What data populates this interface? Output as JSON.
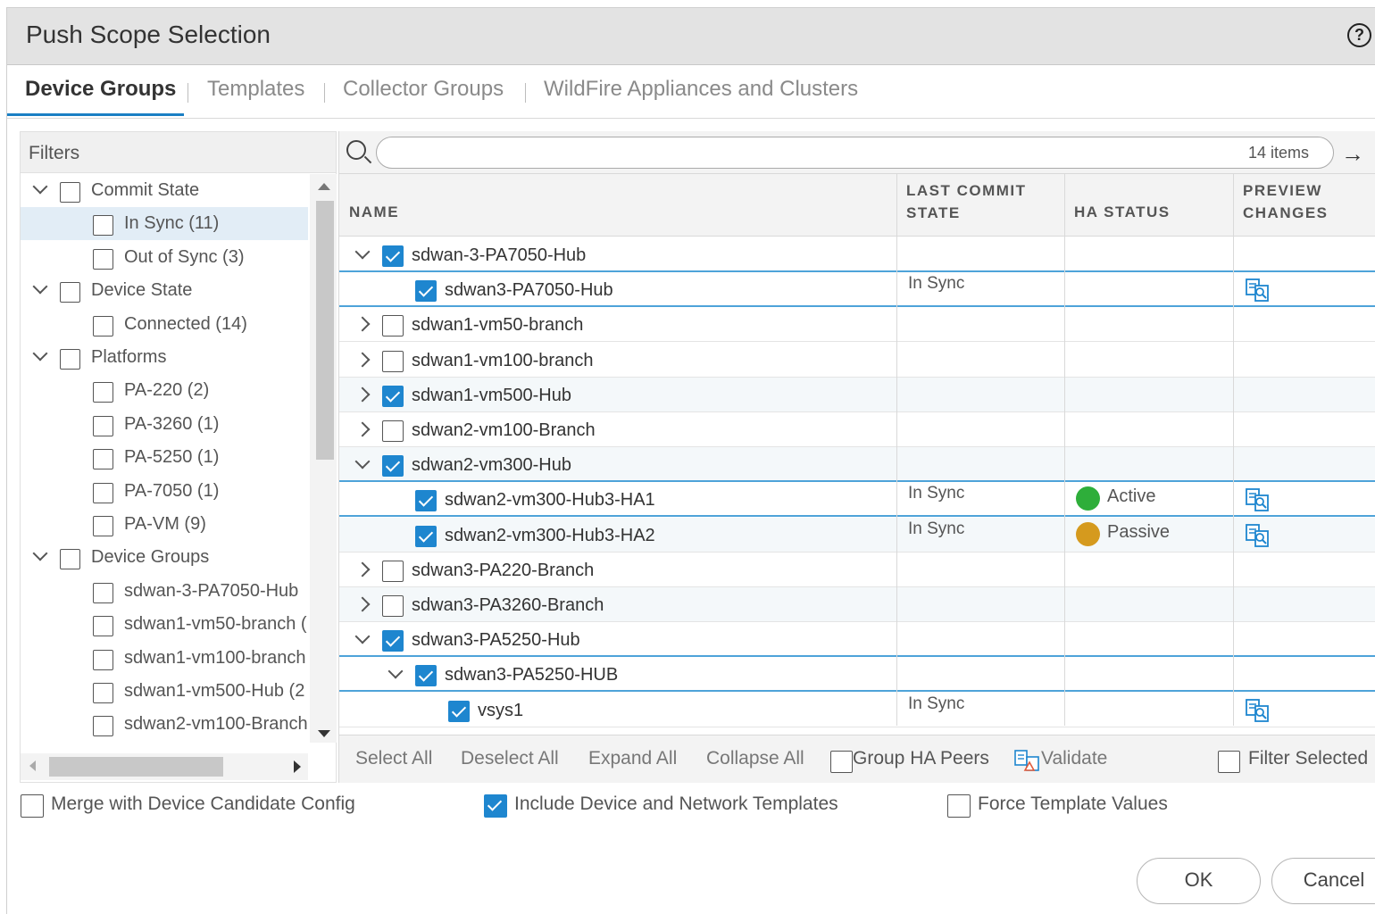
{
  "dialog": {
    "title": "Push Scope Selection",
    "help_icon": "question-circle-icon",
    "help_text": "?"
  },
  "tabs": [
    {
      "label": "Device Groups",
      "active": true
    },
    {
      "label": "Templates",
      "active": false
    },
    {
      "label": "Collector Groups",
      "active": false
    },
    {
      "label": "WildFire Appliances and Clusters",
      "active": false
    }
  ],
  "filters": {
    "title": "Filters",
    "items": [
      {
        "label": "Commit State",
        "level": 0,
        "expanded": true
      },
      {
        "label": "In Sync (11)",
        "level": 1,
        "selected": true
      },
      {
        "label": "Out of Sync (3)",
        "level": 1
      },
      {
        "label": "Device State",
        "level": 0,
        "expanded": true
      },
      {
        "label": "Connected (14)",
        "level": 1
      },
      {
        "label": "Platforms",
        "level": 0,
        "expanded": true
      },
      {
        "label": "PA-220 (2)",
        "level": 1
      },
      {
        "label": "PA-3260 (1)",
        "level": 1
      },
      {
        "label": "PA-5250 (1)",
        "level": 1
      },
      {
        "label": "PA-7050 (1)",
        "level": 1
      },
      {
        "label": "PA-VM (9)",
        "level": 1
      },
      {
        "label": "Device Groups",
        "level": 0,
        "expanded": true
      },
      {
        "label": "sdwan-3-PA7050-Hub",
        "level": 1
      },
      {
        "label": "sdwan1-vm50-branch (",
        "level": 1
      },
      {
        "label": "sdwan1-vm100-branch",
        "level": 1
      },
      {
        "label": "sdwan1-vm500-Hub (2",
        "level": 1
      },
      {
        "label": "sdwan2-vm100-Branch",
        "level": 1
      }
    ]
  },
  "search": {
    "placeholder": "",
    "count_label": "14 items"
  },
  "columns": [
    "NAME",
    "LAST COMMIT STATE",
    "HA STATUS",
    "PREVIEW CHANGES"
  ],
  "column_header_lines": {
    "last_commit_1": "LAST COMMIT",
    "last_commit_2": "STATE",
    "preview_1": "PREVIEW",
    "preview_2": "CHANGES"
  },
  "rows": [
    {
      "name": "sdwan-3-PA7050-Hub",
      "indent": 0,
      "expand": "down",
      "checked": true,
      "state": "",
      "ha": "",
      "preview": false
    },
    {
      "name": "sdwan3-PA7050-Hub",
      "indent": 1,
      "expand": "none",
      "checked": true,
      "state": "In Sync",
      "ha": "",
      "preview": true
    },
    {
      "name": "sdwan1-vm50-branch",
      "indent": 0,
      "expand": "right",
      "checked": false,
      "state": "",
      "ha": "",
      "preview": false
    },
    {
      "name": "sdwan1-vm100-branch",
      "indent": 0,
      "expand": "right",
      "checked": false,
      "state": "",
      "ha": "",
      "preview": false
    },
    {
      "name": "sdwan1-vm500-Hub",
      "indent": 0,
      "expand": "right",
      "checked": true,
      "state": "",
      "ha": "",
      "preview": false
    },
    {
      "name": "sdwan2-vm100-Branch",
      "indent": 0,
      "expand": "right",
      "checked": false,
      "state": "",
      "ha": "",
      "preview": false
    },
    {
      "name": "sdwan2-vm300-Hub",
      "indent": 0,
      "expand": "down",
      "checked": true,
      "state": "",
      "ha": "",
      "preview": false
    },
    {
      "name": "sdwan2-vm300-Hub3-HA1",
      "indent": 1,
      "expand": "none",
      "checked": true,
      "state": "In Sync",
      "ha": "Active",
      "ha_color": "#2eae3a",
      "preview": true
    },
    {
      "name": "sdwan2-vm300-Hub3-HA2",
      "indent": 1,
      "expand": "none",
      "checked": true,
      "state": "In Sync",
      "ha": "Passive",
      "ha_color": "#d59a1e",
      "preview": true
    },
    {
      "name": "sdwan3-PA220-Branch",
      "indent": 0,
      "expand": "right",
      "checked": false,
      "state": "",
      "ha": "",
      "preview": false
    },
    {
      "name": "sdwan3-PA3260-Branch",
      "indent": 0,
      "expand": "right",
      "checked": false,
      "state": "",
      "ha": "",
      "preview": false
    },
    {
      "name": "sdwan3-PA5250-Hub",
      "indent": 0,
      "expand": "down",
      "checked": true,
      "state": "",
      "ha": "",
      "preview": false
    },
    {
      "name": "sdwan3-PA5250-HUB",
      "indent": 1,
      "expand": "down",
      "checked": true,
      "state": "",
      "ha": "",
      "preview": false
    },
    {
      "name": "vsys1",
      "indent": 2,
      "expand": "none",
      "checked": true,
      "state": "In Sync",
      "ha": "",
      "preview": true
    }
  ],
  "footer": {
    "select_all": "Select All",
    "deselect_all": "Deselect All",
    "expand_all": "Expand All",
    "collapse_all": "Collapse All",
    "group_ha_peers": "Group HA Peers",
    "validate": "Validate",
    "filter_selected": "Filter Selected"
  },
  "options": {
    "merge": {
      "label": "Merge with Device Candidate Config",
      "checked": false
    },
    "include_templates": {
      "label": "Include Device and Network Templates",
      "checked": true
    },
    "force_template": {
      "label": "Force Template Values",
      "checked": false
    }
  },
  "buttons": {
    "ok": "OK",
    "cancel": "Cancel"
  },
  "colors": {
    "accent": "#1e86cf",
    "active": "#2eae3a",
    "passive": "#d59a1e",
    "row_highlight": "#4ea3d9"
  }
}
